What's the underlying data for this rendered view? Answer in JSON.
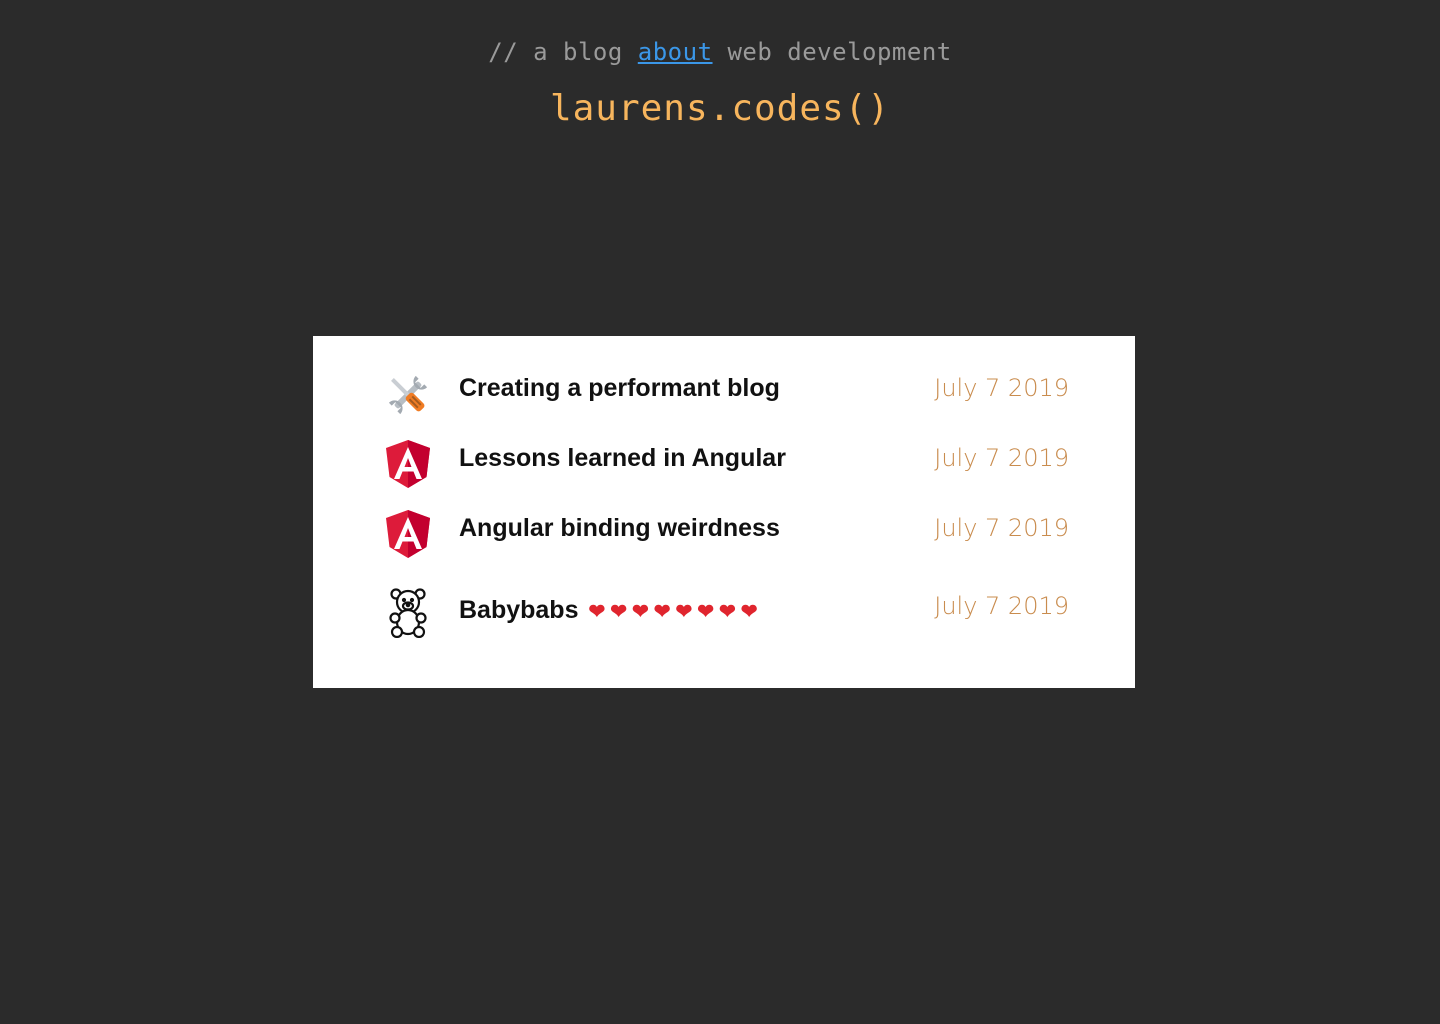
{
  "header": {
    "tagline_prefix": "// a blog ",
    "tagline_link": "about",
    "tagline_suffix": " web development",
    "site_title": "laurens.codes()"
  },
  "colors": {
    "background": "#2b2b2b",
    "tagline": "#9a9a9a",
    "link": "#3b97e8",
    "site_title": "#f7b55d",
    "card": "#ffffff",
    "post_title": "#111111",
    "date": "#c98c4e",
    "angular_red": "#dd1b3a",
    "heart": "#e0252e"
  },
  "posts": [
    {
      "icon": "hammer-and-wrench-icon",
      "title": "Creating a performant blog",
      "date": "July 7 2019"
    },
    {
      "icon": "angular-icon",
      "title": "Lessons learned in Angular",
      "date": "July 7 2019"
    },
    {
      "icon": "angular-icon",
      "title": "Angular binding weirdness",
      "date": "July 7 2019"
    },
    {
      "icon": "teddy-bear-icon",
      "title": "Babybabs",
      "hearts": "❤❤❤❤❤❤❤❤",
      "date": "July 7 2019"
    }
  ]
}
